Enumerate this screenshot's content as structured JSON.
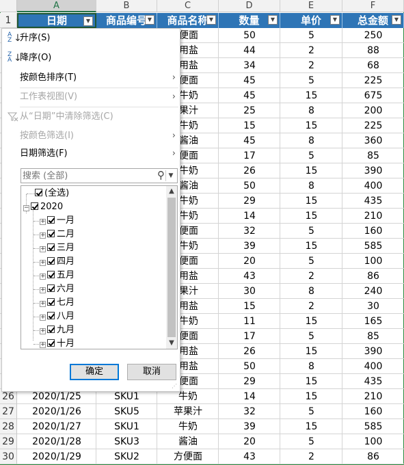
{
  "columns": [
    {
      "letter": "A",
      "header": "日期"
    },
    {
      "letter": "B",
      "header": "商品编号"
    },
    {
      "letter": "C",
      "header": "商品名称"
    },
    {
      "letter": "D",
      "header": "数量"
    },
    {
      "letter": "E",
      "header": "单价"
    },
    {
      "letter": "F",
      "header": "总金额"
    }
  ],
  "header_row_number": "1",
  "visible_partial_rows": [
    {
      "c": "便面",
      "d": "50",
      "e": "5",
      "f": "250"
    },
    {
      "c": "用盐",
      "d": "44",
      "e": "2",
      "f": "88"
    },
    {
      "c": "用盐",
      "d": "34",
      "e": "2",
      "f": "68"
    },
    {
      "c": "便面",
      "d": "45",
      "e": "5",
      "f": "225"
    },
    {
      "c": "牛奶",
      "d": "45",
      "e": "15",
      "f": "675"
    },
    {
      "c": "果汁",
      "d": "25",
      "e": "8",
      "f": "200"
    },
    {
      "c": "牛奶",
      "d": "15",
      "e": "15",
      "f": "225"
    },
    {
      "c": "酱油",
      "d": "45",
      "e": "8",
      "f": "360"
    },
    {
      "c": "便面",
      "d": "17",
      "e": "5",
      "f": "85"
    },
    {
      "c": "牛奶",
      "d": "26",
      "e": "15",
      "f": "390"
    },
    {
      "c": "酱油",
      "d": "50",
      "e": "8",
      "f": "400"
    },
    {
      "c": "牛奶",
      "d": "29",
      "e": "15",
      "f": "435"
    },
    {
      "c": "牛奶",
      "d": "14",
      "e": "15",
      "f": "210"
    },
    {
      "c": "便面",
      "d": "32",
      "e": "5",
      "f": "160"
    },
    {
      "c": "牛奶",
      "d": "39",
      "e": "15",
      "f": "585"
    },
    {
      "c": "便面",
      "d": "20",
      "e": "5",
      "f": "100"
    },
    {
      "c": "用盐",
      "d": "43",
      "e": "2",
      "f": "86"
    },
    {
      "c": "果汁",
      "d": "30",
      "e": "8",
      "f": "240"
    },
    {
      "c": "用盐",
      "d": "15",
      "e": "2",
      "f": "30"
    },
    {
      "c": "牛奶",
      "d": "11",
      "e": "15",
      "f": "165"
    },
    {
      "c": "便面",
      "d": "17",
      "e": "5",
      "f": "85"
    },
    {
      "c": "用盐",
      "d": "26",
      "e": "15",
      "f": "390"
    },
    {
      "c": "用盐",
      "d": "50",
      "e": "8",
      "f": "400"
    },
    {
      "c": "便面",
      "d": "29",
      "e": "15",
      "f": "435"
    }
  ],
  "full_rows": [
    {
      "row": "26",
      "a": "2020/1/25",
      "b": "SKU1",
      "c": "牛奶",
      "d": "14",
      "e": "15",
      "f": "210"
    },
    {
      "row": "27",
      "a": "2020/1/26",
      "b": "SKU5",
      "c": "苹果汁",
      "d": "32",
      "e": "5",
      "f": "160"
    },
    {
      "row": "28",
      "a": "2020/1/27",
      "b": "SKU1",
      "c": "牛奶",
      "d": "39",
      "e": "15",
      "f": "585"
    },
    {
      "row": "29",
      "a": "2020/1/28",
      "b": "SKU3",
      "c": "酱油",
      "d": "20",
      "e": "5",
      "f": "100"
    },
    {
      "row": "30",
      "a": "2020/1/29",
      "b": "SKU2",
      "c": "方便面",
      "d": "43",
      "e": "2",
      "f": "86"
    }
  ],
  "menu": {
    "sort_asc": "升序(S)",
    "sort_desc": "降序(O)",
    "sort_by_color": "按颜色排序(T)",
    "sheet_view": "工作表视图(V)",
    "clear_filter": "从“日期”中清除筛选(C)",
    "filter_by_color": "按颜色筛选(I)",
    "date_filter": "日期筛选(F)",
    "search_placeholder": "搜索 (全部)",
    "tree_select_all": "(全选)",
    "tree_year": "2020",
    "tree_months": [
      "一月",
      "二月",
      "三月",
      "四月",
      "五月",
      "六月",
      "七月",
      "八月",
      "九月",
      "十月"
    ],
    "ok_label": "确定",
    "cancel_label": "取消"
  },
  "icons": {
    "filter_dropdown": "dropdown-arrow-icon",
    "sort_asc": "sort-ascending-icon",
    "sort_desc": "sort-descending-icon",
    "clear_filter": "clear-filter-icon",
    "search": "magnifier-icon",
    "submenu": "chevron-right-icon"
  },
  "colors": {
    "header_fill": "#2e75b6",
    "active_cell_border": "#1e5631",
    "ok_button_border": "#0078d7"
  }
}
